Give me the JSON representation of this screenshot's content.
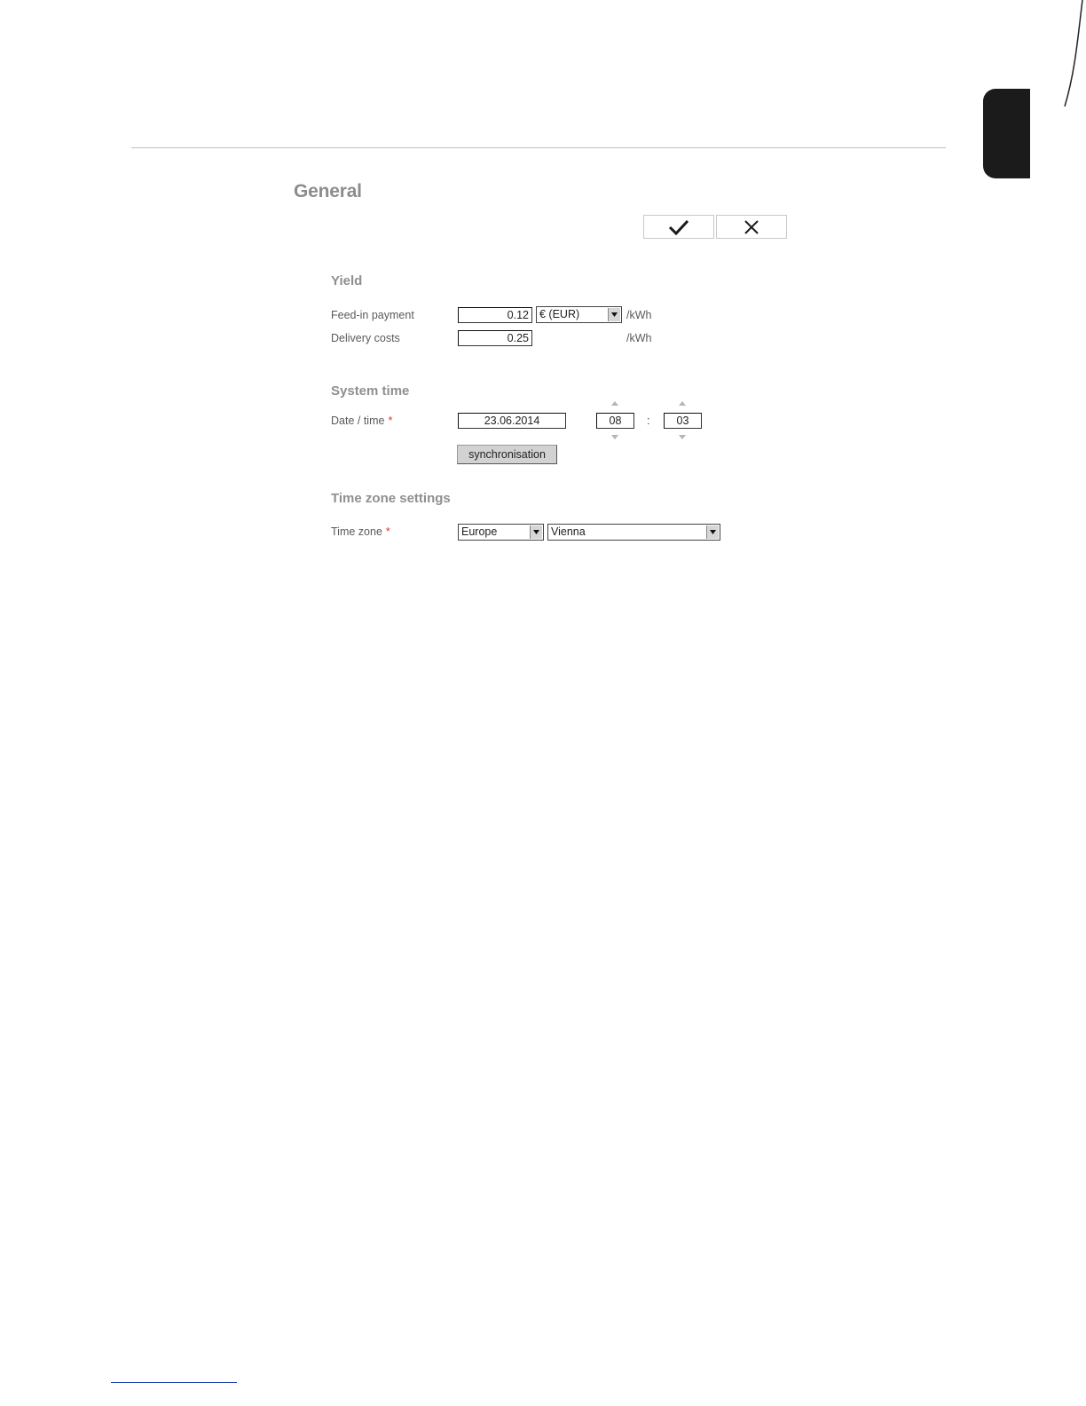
{
  "page": {
    "title": "General"
  },
  "toolbar": {
    "ok_icon": "checkmark-icon",
    "cancel_icon": "close-icon"
  },
  "yield": {
    "title": "Yield",
    "feed_in_label": "Feed-in payment",
    "feed_in_value": "0.12",
    "currency_selected": "€ (EUR)",
    "feed_in_unit": "/kWh",
    "delivery_label": "Delivery costs",
    "delivery_value": "0.25",
    "delivery_unit": "/kWh"
  },
  "system_time": {
    "title": "System time",
    "date_label": "Date / time",
    "required_mark": "*",
    "date_value": "23.06.2014",
    "hour_value": "08",
    "separator": ":",
    "minute_value": "03",
    "sync_label": "synchronisation"
  },
  "time_zone": {
    "title": "Time zone settings",
    "label": "Time zone",
    "required_mark": "*",
    "region_selected": "Europe",
    "city_selected": "Vienna"
  },
  "colors": {
    "accent_dark": "#1b1b1b",
    "footer_link": "#1f3fb0",
    "required": "#d23a3a"
  }
}
